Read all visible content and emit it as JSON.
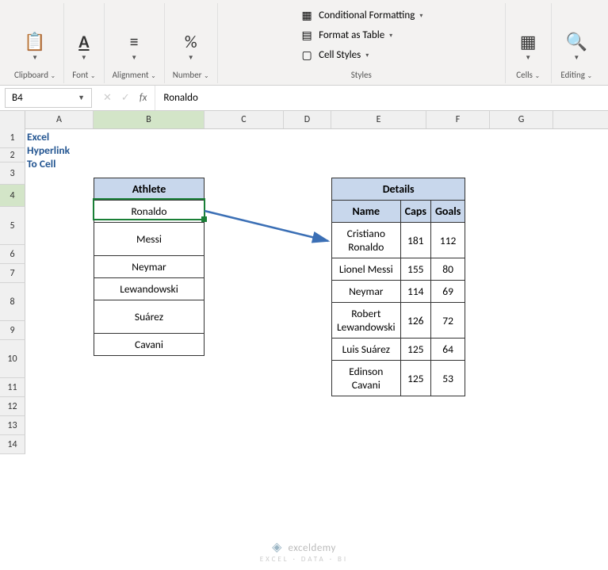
{
  "ribbon": {
    "clipboard": {
      "label": "Clipboard",
      "icon": "📋"
    },
    "font": {
      "label": "Font",
      "icon": "A"
    },
    "alignment": {
      "label": "Alignment",
      "icon": "≡"
    },
    "number": {
      "label": "Number",
      "icon": "%"
    },
    "styles": {
      "label": "Styles",
      "conditional": "Conditional Formatting",
      "table": "Format as Table",
      "cell": "Cell Styles"
    },
    "cells": {
      "label": "Cells"
    },
    "editing": {
      "label": "Editing",
      "icon": "🔍"
    }
  },
  "namebox": "B4",
  "formula": "Ronaldo",
  "columns": [
    "A",
    "B",
    "C",
    "D",
    "E",
    "F",
    "G"
  ],
  "rows": [
    "1",
    "2",
    "3",
    "4",
    "5",
    "6",
    "7",
    "8",
    "9",
    "10",
    "11",
    "12",
    "13",
    "14"
  ],
  "title": "Excel Hyperlink To Cell",
  "athleteTable": {
    "header": "Athlete",
    "rows": [
      "Ronaldo",
      "Messi",
      "Neymar",
      "Lewandowski",
      "Suárez",
      "Cavani"
    ]
  },
  "detailsTable": {
    "header": "Details",
    "cols": [
      "Name",
      "Caps",
      "Goals"
    ],
    "rows": [
      {
        "name": "Cristiano Ronaldo",
        "caps": "181",
        "goals": "112"
      },
      {
        "name": "Lionel Messi",
        "caps": "155",
        "goals": "80"
      },
      {
        "name": "Neymar",
        "caps": "114",
        "goals": "69"
      },
      {
        "name": "Robert Lewandowski",
        "caps": "126",
        "goals": "72"
      },
      {
        "name": "Luis Suárez",
        "caps": "125",
        "goals": "64"
      },
      {
        "name": "Edinson Cavani",
        "caps": "125",
        "goals": "53"
      }
    ]
  },
  "watermark": {
    "brand": "exceldemy",
    "sub": "EXCEL · DATA · BI"
  }
}
